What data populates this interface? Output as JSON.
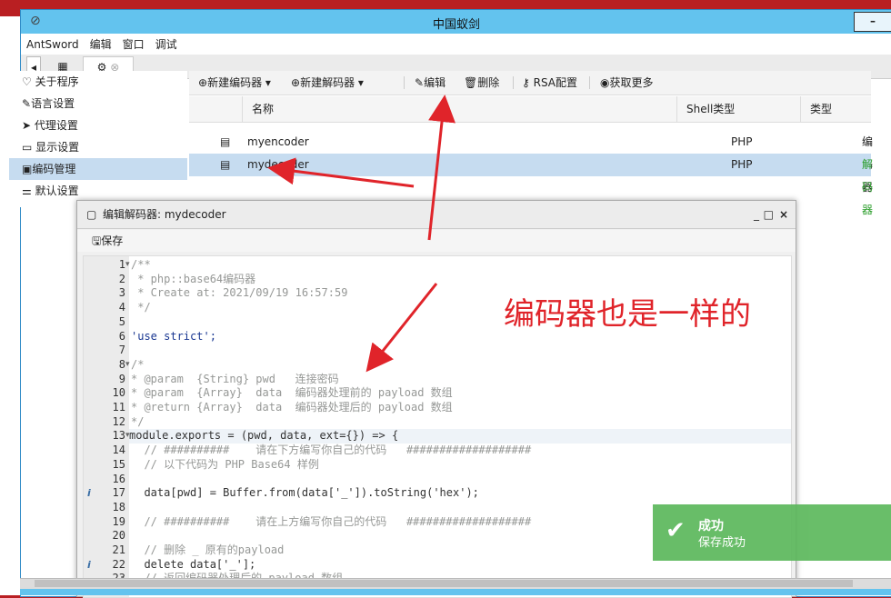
{
  "window": {
    "title": "中国蚁剑"
  },
  "menu": [
    "AntSword",
    "编辑",
    "窗口",
    "调试"
  ],
  "sidebar": {
    "items": [
      {
        "label": "关于程序",
        "icon": "heart-icon"
      },
      {
        "label": "语言设置",
        "icon": "language-icon"
      },
      {
        "label": "代理设置",
        "icon": "send-icon"
      },
      {
        "label": "显示设置",
        "icon": "monitor-icon"
      },
      {
        "label": "编码管理",
        "icon": "code-file-icon"
      },
      {
        "label": "默认设置",
        "icon": "sliders-icon"
      }
    ],
    "active_index": 4
  },
  "toolbar": {
    "new_encoder": "新建编码器",
    "new_decoder": "新建解码器",
    "edit": "编辑",
    "delete": "删除",
    "rsa": "RSA配置",
    "more": "获取更多"
  },
  "grid": {
    "columns": [
      "名称",
      "Shell类型",
      "类型"
    ],
    "rows": [
      {
        "name": "myencoder",
        "shell": "PHP",
        "type": "编码器"
      },
      {
        "name": "mydecoder",
        "shell": "PHP",
        "type": "解码器"
      }
    ],
    "selected_index": 1
  },
  "dialog": {
    "title": "编辑解码器: mydecoder",
    "save_label": "保存",
    "code_lines": [
      {
        "n": "1",
        "fold": "▾",
        "text": "/**",
        "cls": "cmt"
      },
      {
        "n": "2",
        "text": " * php::base64编码器",
        "cls": "cmt"
      },
      {
        "n": "3",
        "text": " * Create at: 2021/09/19 16:57:59",
        "cls": "cmt"
      },
      {
        "n": "4",
        "text": " */",
        "cls": "cmt"
      },
      {
        "n": "5",
        "text": ""
      },
      {
        "n": "6",
        "text": "'use strict';",
        "cls": "str"
      },
      {
        "n": "7",
        "text": ""
      },
      {
        "n": "8",
        "fold": "▾",
        "text": "/*",
        "cls": "cmt"
      },
      {
        "n": "9",
        "text": "* @param  {String} pwd   连接密码",
        "cls": "cmt"
      },
      {
        "n": "10",
        "text": "* @param  {Array}  data  编码器处理前的 payload 数组",
        "cls": "cmt"
      },
      {
        "n": "11",
        "text": "* @return {Array}  data  编码器处理后的 payload 数组",
        "cls": "cmt"
      },
      {
        "n": "12",
        "text": "*/",
        "cls": "cmt"
      },
      {
        "n": "13",
        "fold": "▾",
        "text": "module.exports = (pwd, data, ext={}) => {",
        "hl": true
      },
      {
        "n": "14",
        "text": "  // ##########    请在下方编写你自己的代码   ###################",
        "cls": "cmt"
      },
      {
        "n": "15",
        "text": "  // 以下代码为 PHP Base64 样例",
        "cls": "cmt"
      },
      {
        "n": "16",
        "text": ""
      },
      {
        "n": "17",
        "info": "i",
        "text": "  data[pwd] = Buffer.from(data['_']).toString('hex');"
      },
      {
        "n": "18",
        "text": ""
      },
      {
        "n": "19",
        "text": "  // ##########    请在上方编写你自己的代码   ###################",
        "cls": "cmt"
      },
      {
        "n": "20",
        "text": ""
      },
      {
        "n": "21",
        "text": "  // 删除 _ 原有的payload",
        "cls": "cmt"
      },
      {
        "n": "22",
        "info": "i",
        "text": "  delete data['_'];"
      },
      {
        "n": "23",
        "text": "  // 返回编码器处理后的 payload 数组",
        "cls": "cmt"
      }
    ]
  },
  "annotation": "编码器也是一样的",
  "toast": {
    "title": "成功",
    "message": "保存成功"
  },
  "colors": {
    "titlebar": "#63c3ee",
    "accent_red": "#e0242a",
    "success": "#5cb85c",
    "selected_row": "#c6dcf0"
  }
}
